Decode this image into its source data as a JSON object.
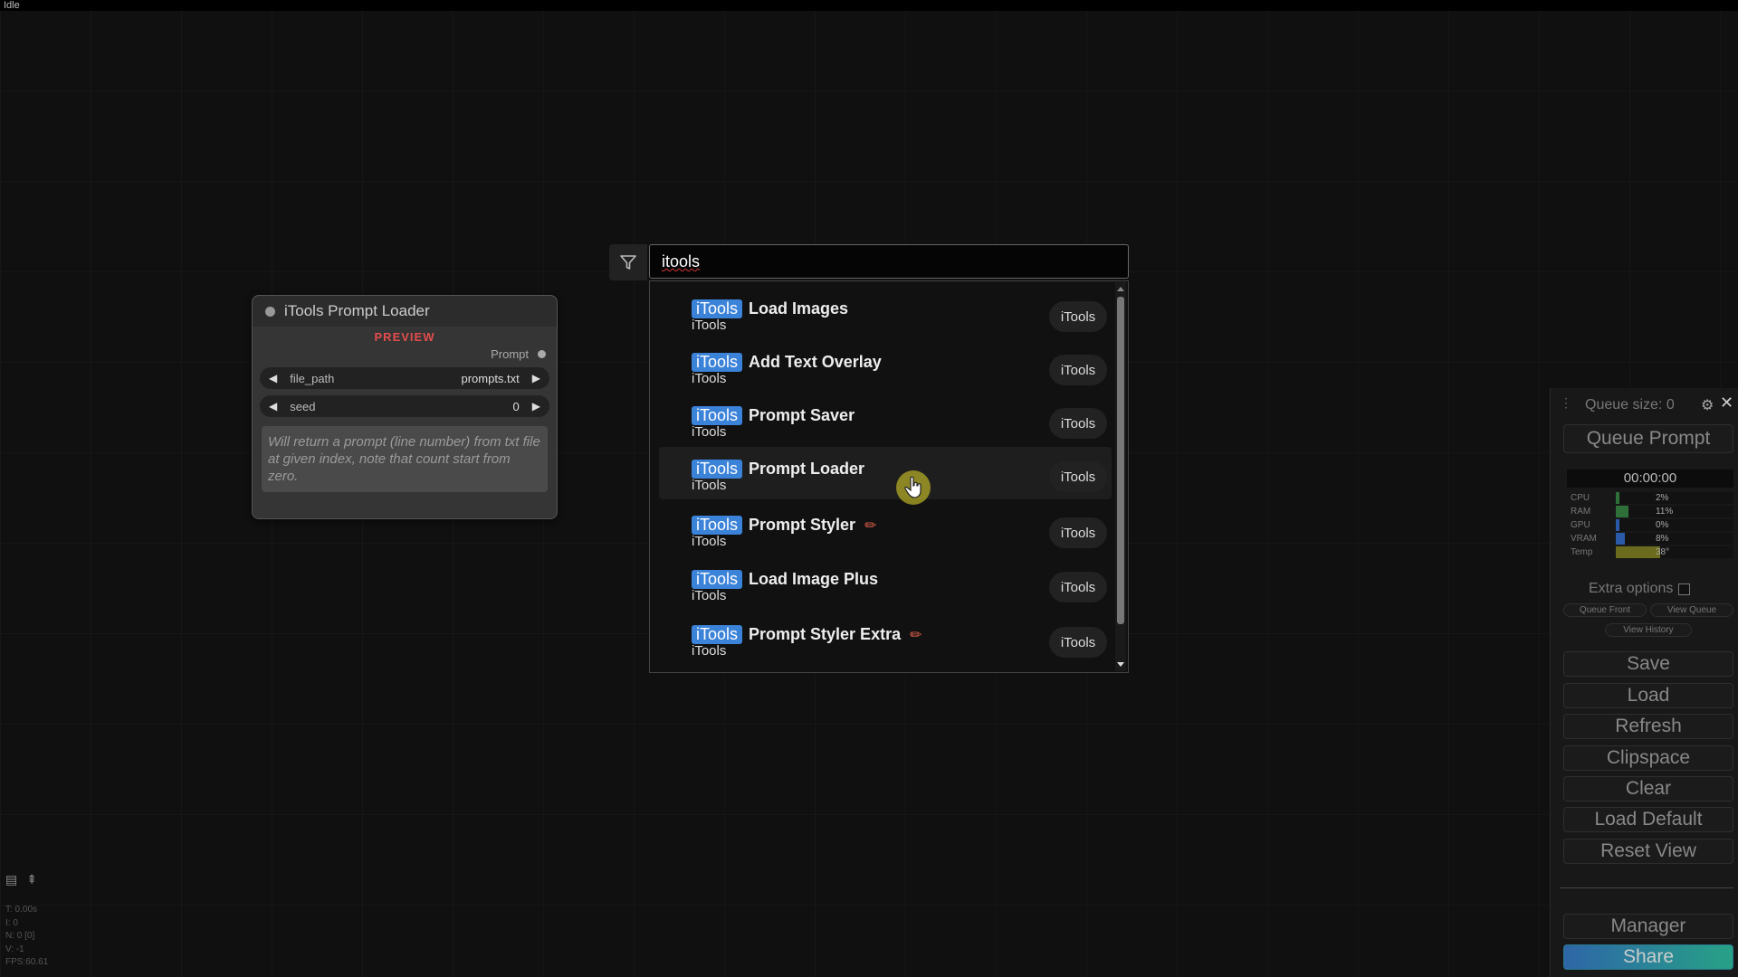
{
  "status": "Idle",
  "node": {
    "title": "iTools Prompt Loader",
    "badge": "PREVIEW",
    "output_label": "Prompt",
    "widgets": [
      {
        "name": "file_path",
        "value": "prompts.txt"
      },
      {
        "name": "seed",
        "value": "0"
      }
    ],
    "description": "Will return a prompt (line number) from txt file at given index, note that count start from zero."
  },
  "search": {
    "value": "itools",
    "results": [
      {
        "tag": "iTools",
        "title": "Load Images",
        "sub": "iTools",
        "pill": "iTools",
        "edit": false
      },
      {
        "tag": "iTools",
        "title": "Add Text Overlay",
        "sub": "iTools",
        "pill": "iTools",
        "edit": false
      },
      {
        "tag": "iTools",
        "title": "Prompt Saver",
        "sub": "iTools",
        "pill": "iTools",
        "edit": false
      },
      {
        "tag": "iTools",
        "title": "Prompt Loader",
        "sub": "iTools",
        "pill": "iTools",
        "edit": false
      },
      {
        "tag": "iTools",
        "title": "Prompt Styler",
        "sub": "iTools",
        "pill": "iTools",
        "edit": true
      },
      {
        "tag": "iTools",
        "title": "Load Image Plus",
        "sub": "iTools",
        "pill": "iTools",
        "edit": false
      },
      {
        "tag": "iTools",
        "title": "Prompt Styler Extra",
        "sub": "iTools",
        "pill": "iTools",
        "edit": true
      }
    ]
  },
  "panel": {
    "queue_size": "Queue size: 0",
    "queue_button": "Queue Prompt",
    "timer": "00:00:00",
    "stats": [
      {
        "label": "CPU",
        "value": "2%",
        "level": 0.02,
        "color": "#2f6f3a"
      },
      {
        "label": "RAM",
        "value": "11%",
        "level": 0.11,
        "color": "#2f6f3a"
      },
      {
        "label": "GPU",
        "value": "0%",
        "level": 0.0,
        "color": "#2a5aa8"
      },
      {
        "label": "VRAM",
        "value": "8%",
        "level": 0.08,
        "color": "#2a5aa8"
      },
      {
        "label": "Temp",
        "value": "38°",
        "level": 0.38,
        "color": "#6b6b1e"
      }
    ],
    "extra_options": "Extra options",
    "queue_front": "Queue Front",
    "view_queue": "View Queue",
    "view_history": "View History",
    "buttons": [
      "Save",
      "Load",
      "Refresh",
      "Clipspace",
      "Clear",
      "Load Default",
      "Reset View"
    ],
    "manager": "Manager",
    "share": "Share"
  },
  "bottom_stats": [
    "T: 0.00s",
    "I: 0",
    "N: 0 [0]",
    "V: -1",
    "FPS:60.61"
  ],
  "colors": {
    "accent_tag": "#3b82d9",
    "badge": "#e24c4c",
    "cursor": "#c8be28"
  }
}
